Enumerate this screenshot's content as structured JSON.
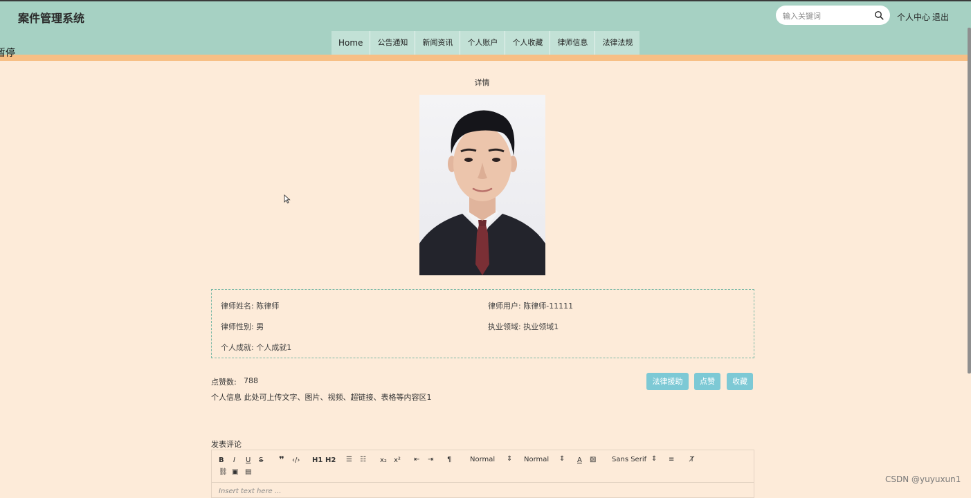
{
  "header": {
    "site_title": "案件管理系统",
    "search_placeholder": "输入关键词",
    "personal_center": "个人中心",
    "logout": "退出"
  },
  "nav": {
    "items": [
      "Home",
      "公告通知",
      "新闻资讯",
      "个人账户",
      "个人收藏",
      "律师信息",
      "法律法规"
    ]
  },
  "overflow_text": "暂停",
  "detail": {
    "title": "详情",
    "photo_icon": "lawyer-portrait-photo"
  },
  "info": {
    "name_label": "律师姓名:",
    "name_value": "陈律师",
    "user_label": "律师用户:",
    "user_value": "陈律师-11111",
    "gender_label": "律师性别:",
    "gender_value": "男",
    "field_label": "执业领域:",
    "field_value": "执业领域1",
    "achievement_label": "个人成就:",
    "achievement_value": "个人成就1"
  },
  "stats": {
    "likes_label": "点赞数:",
    "likes_value": "788",
    "personal_info": "个人信息  此处可上传文字、图片、视频、超链接、表格等内容区1"
  },
  "buttons": {
    "legal_aid": "法律援助",
    "like": "点赞",
    "favorite": "收藏"
  },
  "comment": {
    "label": "发表评论",
    "toolbar": {
      "bold": "B",
      "italic": "I",
      "underline": "U",
      "strike": "S",
      "h1": "H1",
      "h2": "H2",
      "sub": "x₂",
      "sup": "x²",
      "size": "Normal",
      "header_select": "Normal",
      "font": "Sans Serif"
    },
    "placeholder": "Insert text here ..."
  },
  "watermark": "CSDN @yuyuxun1"
}
